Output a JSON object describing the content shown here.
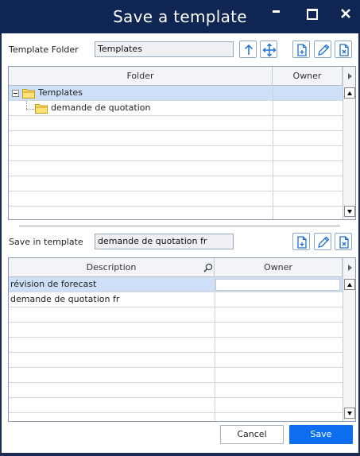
{
  "window": {
    "title": "Save a template"
  },
  "template_folder": {
    "label": "Template Folder",
    "value": "Templates"
  },
  "folder_grid": {
    "headers": {
      "folder": "Folder",
      "owner": "Owner"
    },
    "rows": [
      {
        "name": "Templates",
        "owner": "",
        "selected": true
      },
      {
        "name": "demande de quotation",
        "owner": "",
        "selected": false
      }
    ]
  },
  "save_in": {
    "label": "Save in template",
    "value": "demande de quotation fr"
  },
  "template_grid": {
    "headers": {
      "description": "Description",
      "owner": "Owner"
    },
    "rows": [
      {
        "description": "révision de forecast",
        "owner": "",
        "selected": true
      },
      {
        "description": "demande de quotation fr",
        "owner": "",
        "selected": false
      }
    ]
  },
  "buttons": {
    "cancel": "Cancel",
    "save": "Save"
  },
  "icons": {
    "minimize": "minimize-icon",
    "maximize": "maximize-icon",
    "close": "close-icon",
    "up": "arrow-up-icon",
    "move": "move-icon",
    "new": "new-file-icon",
    "edit": "pencil-icon",
    "delete": "delete-file-icon",
    "folder": "folder-icon",
    "search": "search-icon",
    "collapse": "collapse-icon"
  },
  "colors": {
    "titlebar": "#0f2654",
    "selected_row": "#cde0f7",
    "save_button": "#0d6ef0",
    "icon_blue": "#1a6fd6"
  }
}
